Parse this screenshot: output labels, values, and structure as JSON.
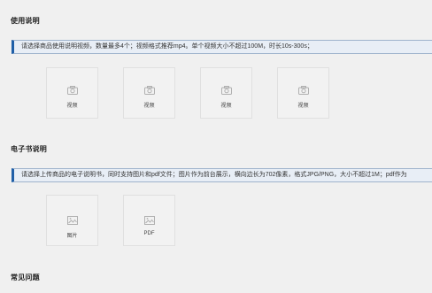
{
  "usage": {
    "title": "使用说明",
    "notice": "请选择商品使用说明视频，数量最多4个；视频格式推荐mp4。单个视频大小不超过100M，时长10s-300s；",
    "slots": [
      {
        "label": "视频",
        "icon": "camera-icon"
      },
      {
        "label": "视频",
        "icon": "camera-icon"
      },
      {
        "label": "视频",
        "icon": "camera-icon"
      },
      {
        "label": "视频",
        "icon": "camera-icon"
      }
    ]
  },
  "ebook": {
    "title": "电子书说明",
    "notice": "请选择上传商品的电子说明书，同时支持图片和pdf文件；图片作为前台展示，横向边长为702像素，格式JPG/PNG，大小不超过1M；pdf作为",
    "slots": [
      {
        "label": "图片",
        "icon": "image-icon"
      },
      {
        "label": "PDF",
        "icon": "image-icon"
      }
    ]
  },
  "faq": {
    "title": "常见问题"
  },
  "colors": {
    "accent": "#1f5fa8",
    "notice_bg": "#e8eef6",
    "page_bg": "#f0f0f0"
  }
}
